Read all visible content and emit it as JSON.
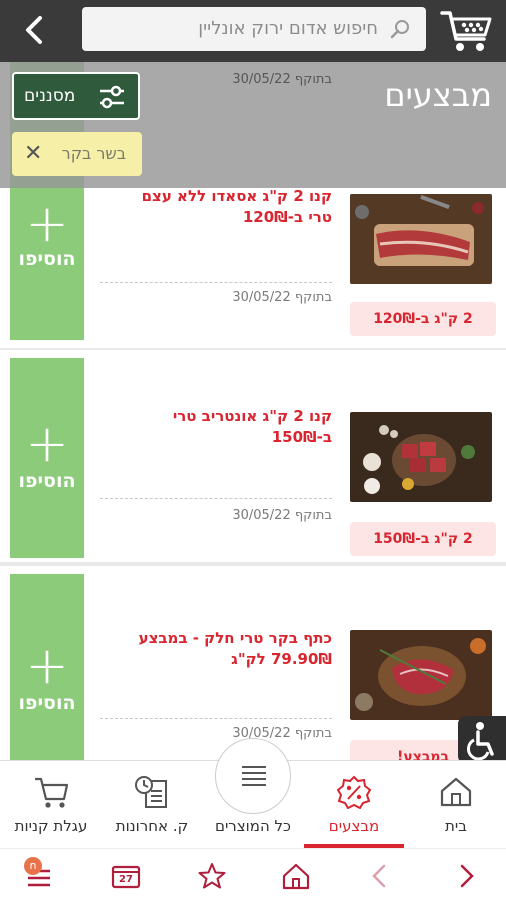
{
  "header": {
    "search_placeholder": "חיפוש אדום ירוק אונליין"
  },
  "filter_bar": {
    "page_title": "מבצעים",
    "filters_label": "מסננים",
    "chip_label": "בשר בקר",
    "faded_validity": "בתוקף 30/05/22"
  },
  "promotions": [
    {
      "title": "קנו 2 ק\"ג אסאדו ללא עצם טרי ב-120₪",
      "validity": "בתוקף 30/05/22",
      "badge": "2 ק\"ג ב-120₪",
      "add_label": "הוסיפו"
    },
    {
      "title": "קנו 2 ק\"ג אונטריב טרי ב-150₪",
      "validity": "בתוקף 30/05/22",
      "badge": "2 ק\"ג ב-150₪",
      "add_label": "הוסיפו"
    },
    {
      "title": "כתף בקר טרי חלק - במבצע 79.90₪ לק\"ג",
      "validity": "בתוקף 30/05/22",
      "badge": "במבצע!",
      "add_label": "הוסיפו"
    }
  ],
  "bottom_nav": {
    "home": "בית",
    "deals": "מבצעים",
    "all_products": "כל המוצרים",
    "recent_purchases": "ק. אחרונות",
    "cart": "עגלת קניות"
  },
  "system_bar": {
    "notification_count": "n",
    "calendar_day": "27"
  },
  "colors": {
    "accent_red": "#d9252f",
    "add_green": "#8bcb7a",
    "header_dark": "#3a3a3a",
    "chip_yellow": "#f5efa8"
  }
}
